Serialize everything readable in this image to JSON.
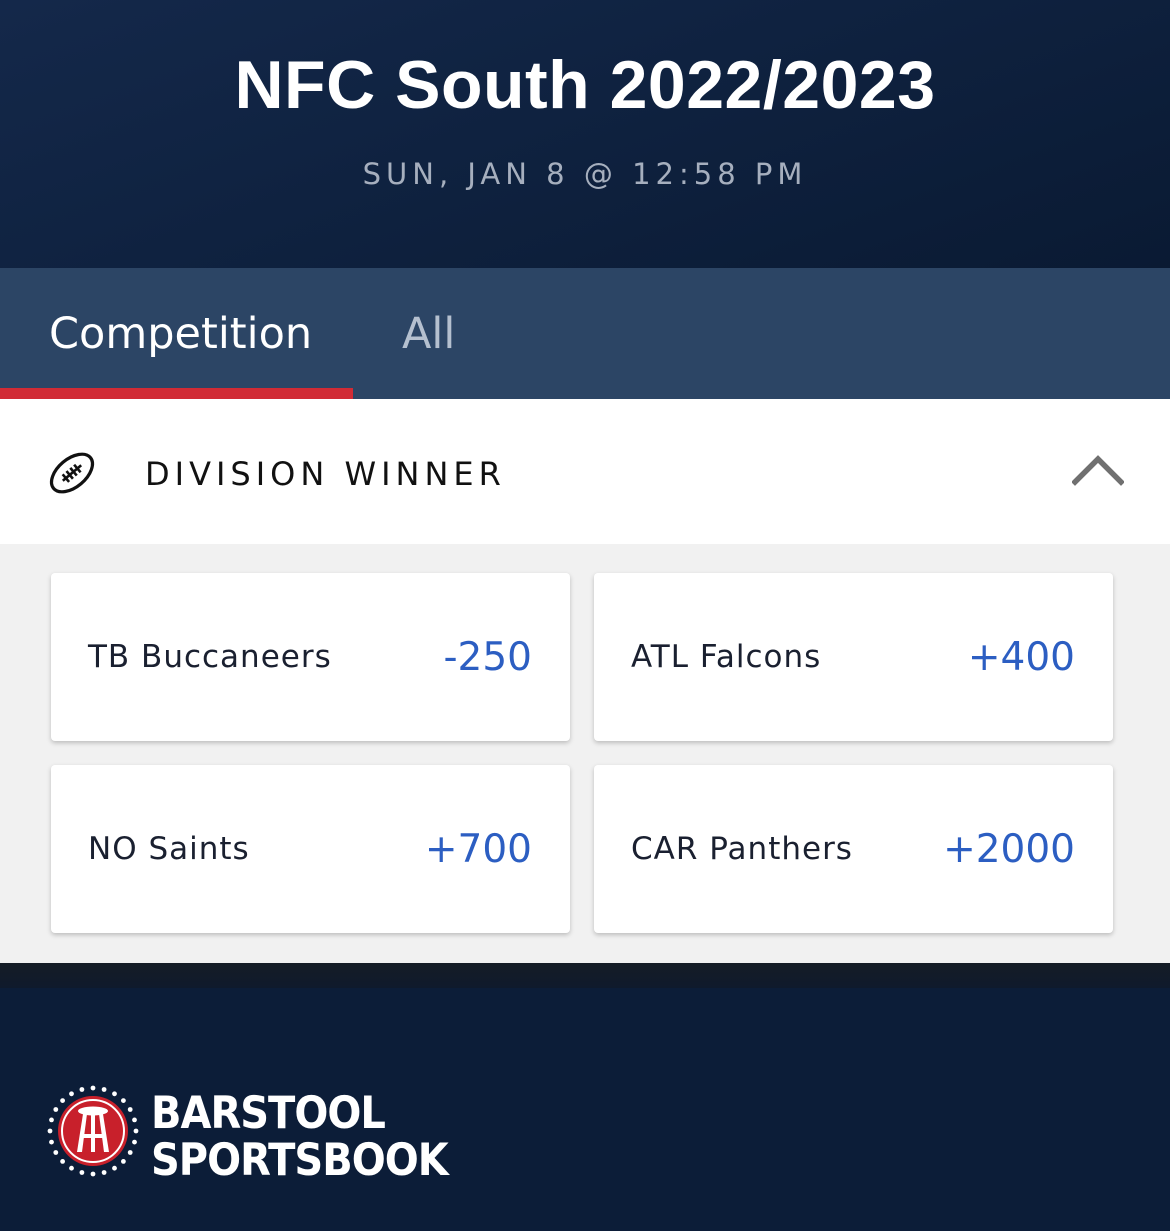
{
  "header": {
    "title": "NFC South 2022/2023",
    "subtitle": "SUN, JAN 8 @ 12:58 PM"
  },
  "tabs": [
    {
      "label": "Competition",
      "active": true
    },
    {
      "label": "All",
      "active": false
    }
  ],
  "section": {
    "icon": "football-icon",
    "title": "DIVISION WINNER",
    "expanded": true
  },
  "markets": [
    {
      "team": "TB Buccaneers",
      "odds": "-250"
    },
    {
      "team": "ATL Falcons",
      "odds": "+400"
    },
    {
      "team": "NO Saints",
      "odds": "+700"
    },
    {
      "team": "CAR Panthers",
      "odds": "+2000"
    }
  ],
  "footer": {
    "logo_line1": "BARSTOOL",
    "logo_line2": "SPORTSBOOK"
  },
  "colors": {
    "navy": "#0c1d38",
    "tab_bar": "#2c4565",
    "accent_red": "#d12b35",
    "odds_blue": "#2c5ec2"
  }
}
